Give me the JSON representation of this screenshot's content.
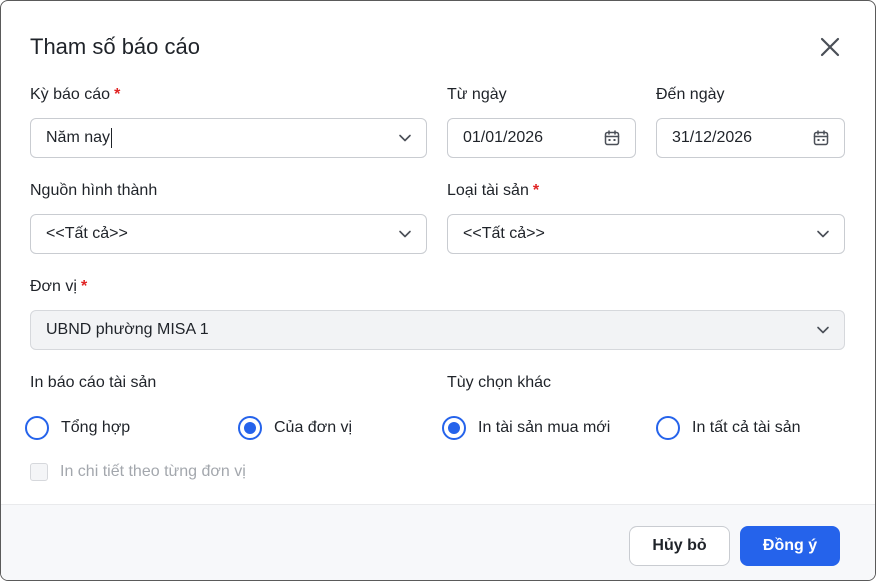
{
  "dialog": {
    "title": "Tham số báo cáo"
  },
  "form": {
    "period": {
      "label": "Kỳ báo cáo",
      "value": "Năm nay"
    },
    "from_date": {
      "label": "Từ ngày",
      "value": "01/01/2026"
    },
    "to_date": {
      "label": "Đến ngày",
      "value": "31/12/2026"
    },
    "funding_source": {
      "label": "Nguồn hình thành",
      "value": "<<Tất cả>>"
    },
    "asset_type": {
      "label": "Loại tài sản",
      "value": "<<Tất cả>>"
    },
    "unit": {
      "label": "Đơn vị",
      "value": "UBND phường MISA 1"
    },
    "print_report": {
      "label": "In báo cáo tài sản",
      "options": [
        {
          "label": "Tổng hợp",
          "selected": false
        },
        {
          "label": "Của đơn vị",
          "selected": true
        }
      ]
    },
    "other_options": {
      "label": "Tùy chọn khác",
      "options": [
        {
          "label": "In tài sản mua mới",
          "selected": true
        },
        {
          "label": "In tất cả tài sản",
          "selected": false
        }
      ]
    },
    "detail_checkbox": {
      "label": "In chi tiết theo từng đơn vị",
      "checked": false,
      "disabled": true
    },
    "required_mark": "*"
  },
  "footer": {
    "cancel_label": "Hủy bỏ",
    "ok_label": "Đồng ý"
  },
  "colors": {
    "primary": "#2563eb",
    "required": "#e02424",
    "border": "#c9ccd1",
    "disabled_bg": "#f2f3f5",
    "footer_bg": "#f7f8fa"
  }
}
